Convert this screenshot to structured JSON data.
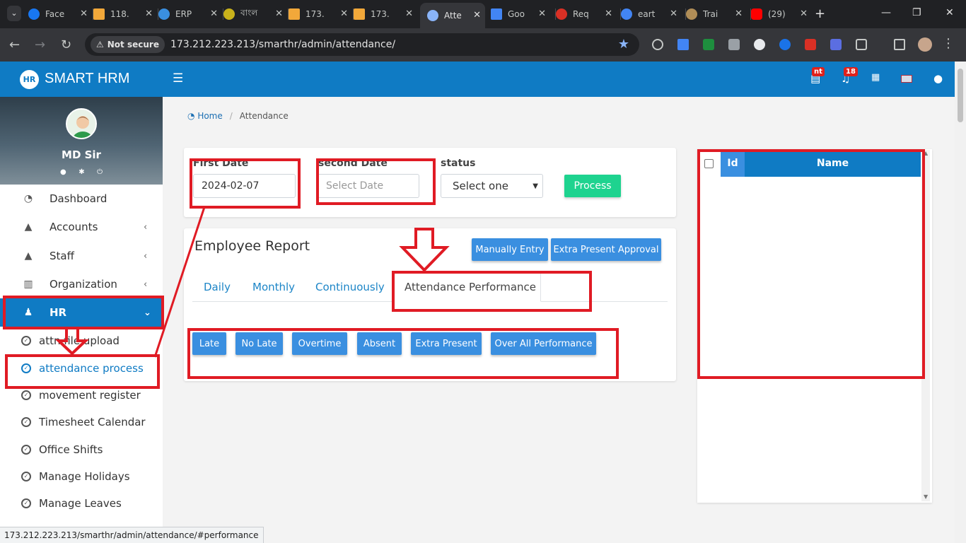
{
  "browser": {
    "tabs": [
      {
        "label": "Face",
        "color": "#1877f2"
      },
      {
        "label": "118.",
        "color": "#f2a83a"
      },
      {
        "label": "ERP",
        "color": "#3a8fe0"
      },
      {
        "label": "বাংল",
        "color": "#c9b21b"
      },
      {
        "label": "173.",
        "color": "#f2a83a"
      },
      {
        "label": "173.",
        "color": "#f2a83a"
      },
      {
        "label": "Atte",
        "color": "#8ab4f8"
      },
      {
        "label": "Goo",
        "color": "#4285f4"
      },
      {
        "label": "Req",
        "color": "#d93025"
      },
      {
        "label": "eart",
        "color": "#4285f4"
      },
      {
        "label": "Trai",
        "color": "#b08d57"
      },
      {
        "label": "(29)",
        "color": "#ff0000"
      }
    ],
    "not_secure": "Not secure",
    "url_host": "173.212.223.213",
    "url_path": "/smarthr/admin/attendance/",
    "status_url": "173.212.223.213/smarthr/admin/attendance/#performance"
  },
  "header": {
    "brand": "SMART HRM",
    "logo_text": "HR",
    "badges": {
      "messages": "nt",
      "notifications": "18"
    }
  },
  "sidebar": {
    "user_name": "MD Sir",
    "menu": [
      {
        "label": "Dashboard",
        "icon": "dashboard-icon"
      },
      {
        "label": "Accounts",
        "icon": "user-icon"
      },
      {
        "label": "Staff",
        "icon": "user-icon"
      },
      {
        "label": "Organization",
        "icon": "building-icon"
      },
      {
        "label": "HR",
        "icon": "users-icon"
      }
    ],
    "submenu": [
      "attn file upload",
      "attendance process",
      "movement register",
      "Timesheet Calendar",
      "Office Shifts",
      "Manage Holidays",
      "Manage Leaves"
    ]
  },
  "breadcrumb": {
    "home": "Home",
    "current": "Attendance"
  },
  "filter": {
    "first_date_label": "First Date",
    "first_date_value": "2024-02-07",
    "second_date_label": "second Date",
    "second_date_placeholder": "Select Date",
    "status_label": "status",
    "status_selected": "Select one",
    "process_button": "Process"
  },
  "report": {
    "title": "Employee Report",
    "manual_entry": "Manually Entry",
    "extra_present_approval": "Extra Present Approval",
    "tabs": [
      "Daily",
      "Monthly",
      "Continuously",
      "Attendance Performance"
    ],
    "active_tab": "Attendance Performance",
    "performance_buttons": [
      "Late",
      "No Late",
      "Overtime",
      "Absent",
      "Extra Present",
      "Over All Performance"
    ]
  },
  "table": {
    "col_id": "Id",
    "col_name": "Name"
  },
  "annotations": {
    "color": "#e01b24"
  }
}
